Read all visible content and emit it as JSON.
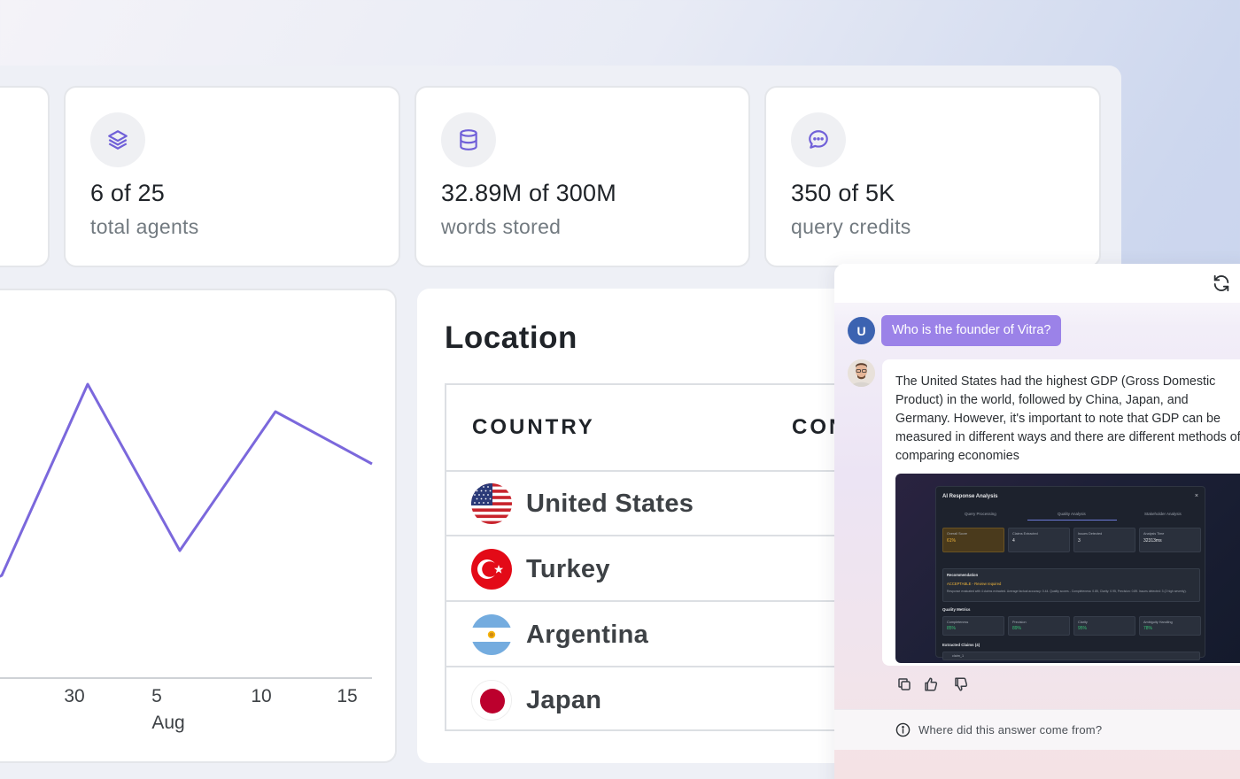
{
  "stats": [
    {
      "icon": "layers-icon",
      "value": "6 of 25",
      "label": "total agents"
    },
    {
      "icon": "database-icon",
      "value": "32.89M of 300M",
      "label": "words stored"
    },
    {
      "icon": "chat-bubble-icon",
      "value": "350 of 5K",
      "label": "query credits"
    }
  ],
  "chart_data": {
    "type": "line",
    "x": [
      "",
      "30",
      "",
      "5",
      "",
      "10",
      "",
      "15"
    ],
    "xtick_labels": [
      "30",
      "5",
      "10",
      "15"
    ],
    "xlabel": "Aug",
    "series": [
      {
        "values": [
          null,
          null,
          null,
          null,
          null,
          null,
          null,
          null
        ]
      }
    ],
    "color": "#7b68dc"
  },
  "location": {
    "title": "Location",
    "col_country": "COUNTRY",
    "col_second": "CON",
    "rows": [
      {
        "country": "United States",
        "flag": "us-flag"
      },
      {
        "country": "Turkey",
        "flag": "turkey-flag"
      },
      {
        "country": "Argentina",
        "flag": "argentina-flag"
      },
      {
        "country": "Japan",
        "flag": "japan-flag"
      }
    ]
  },
  "chat": {
    "user_initial": "U",
    "user_question": "Who is the founder of Vitra?",
    "answer": "The United States had the highest GDP (Gross Domestic Product) in the world, followed by China, Japan, and Germany. However, it's important to note that GDP can be measured in different ways and there are different methods of comparing economies",
    "embedded_screenshot": {
      "title": "AI Response Analysis",
      "close": "×",
      "tabs": [
        "Query Processing",
        "Quality Analysis",
        "Stakeholder Analysis"
      ],
      "metrics": [
        {
          "label": "Overall Score",
          "value": "61%"
        },
        {
          "label": "Claims Extracted",
          "value": "4"
        },
        {
          "label": "Issues Detected",
          "value": "3"
        },
        {
          "label": "Analysis Time",
          "value": "32313ms"
        }
      ],
      "recommendation_label": "Recommendation",
      "recommendation_value": "ACCEPTABLE - Review required",
      "recommendation_detail": "Response evaluated with 4 claims extracted. Average factual accuracy: 0.44. Quality scores - Completeness: 0.85, Clarity: 0.95, Precision: 0.89. Issues detected: 3 (2 high severity).",
      "quality_label": "Quality Metrics",
      "quality": [
        {
          "label": "Completeness",
          "value": "85%"
        },
        {
          "label": "Precision",
          "value": "89%"
        },
        {
          "label": "Clarity",
          "value": "95%"
        },
        {
          "label": "Ambiguity Handling",
          "value": "78%"
        }
      ],
      "claims_label": "Extracted Claims (4)",
      "claim_item": "claim_1"
    },
    "source_prompt": "Where did this answer come from?"
  }
}
